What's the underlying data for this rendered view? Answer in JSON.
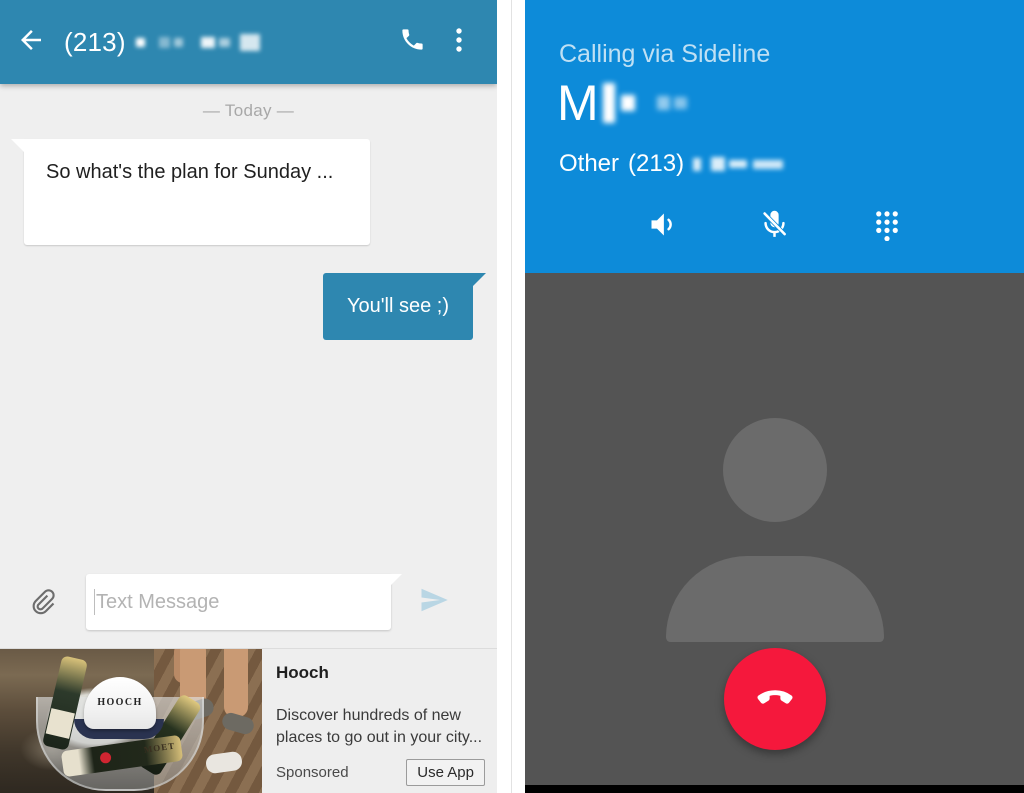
{
  "messaging": {
    "appbar": {
      "back_icon": "arrow-back-icon",
      "title_prefix": "(213)",
      "title_redacted": true,
      "call_icon": "phone-icon",
      "menu_icon": "overflow-menu-icon"
    },
    "day_divider": "— Today —",
    "messages": [
      {
        "direction": "incoming",
        "text": "So what's the plan for Sunday ..."
      },
      {
        "direction": "outgoing",
        "text": "You'll see ;)"
      }
    ],
    "composer": {
      "attach_icon": "paperclip-icon",
      "input_value": "",
      "input_placeholder": "Text Message",
      "send_icon": "send-icon"
    },
    "ad": {
      "image_alt": "champagne-bottles-hooch-cap",
      "image_cap_text": "HOOCH",
      "image_bottle_label": "MOET",
      "title": "Hooch",
      "description": "Discover hundreds of new places to go out in your city...",
      "sponsored_label": "Sponsored",
      "cta_label": "Use App"
    },
    "colors": {
      "appbar": "#2e87b0",
      "outgoing_bubble": "#2e87b0",
      "incoming_bubble": "#ffffff",
      "chat_background": "#efefef"
    }
  },
  "call": {
    "status": "Calling via Sideline",
    "contact_name_prefix": "M",
    "contact_name_redacted": true,
    "number_label": "Other",
    "number_prefix": "(213)",
    "number_redacted": true,
    "controls": [
      {
        "name": "speaker-icon",
        "label": "Speaker",
        "state": "on"
      },
      {
        "name": "mic-muted-icon",
        "label": "Mute",
        "state": "muted"
      },
      {
        "name": "dialpad-icon",
        "label": "Dialpad",
        "state": "off"
      }
    ],
    "avatar_placeholder": "person-avatar-icon",
    "end_call": {
      "icon": "end-call-icon",
      "label": "End call"
    },
    "colors": {
      "header": "#0d8bd9",
      "body": "#545454",
      "end_call": "#f5183c",
      "status_text": "#bfe0f4"
    }
  }
}
